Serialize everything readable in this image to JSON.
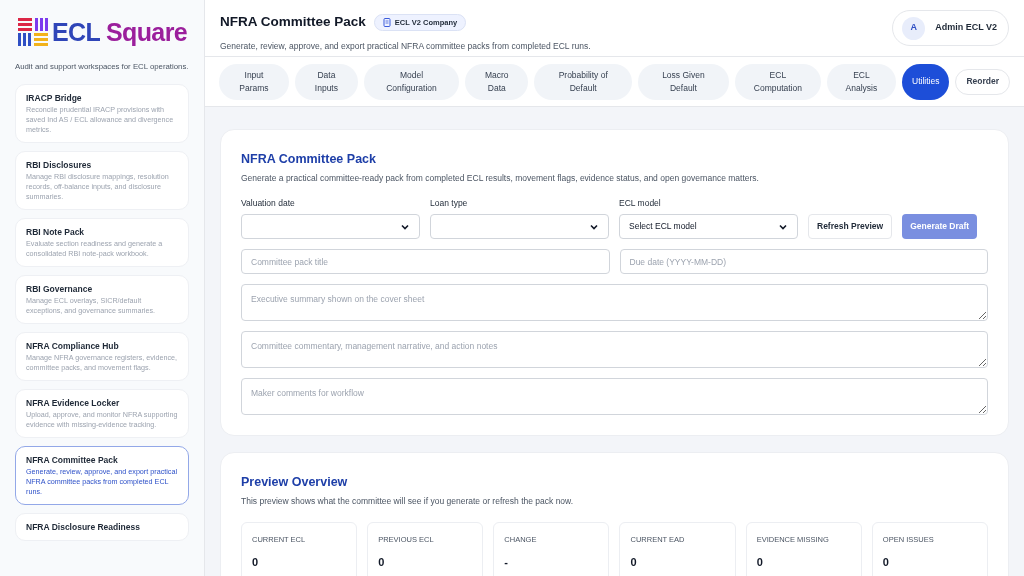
{
  "sidebar": {
    "logo": {
      "word1": "ECL",
      "word2": "Square"
    },
    "tagline": "Audit and support workspaces for ECL operations.",
    "items": [
      {
        "title": "IRACP Bridge",
        "description": "Reconcile prudential IRACP provisions with saved Ind AS / ECL allowance and divergence metrics.",
        "selected": false
      },
      {
        "title": "RBI Disclosures",
        "description": "Manage RBI disclosure mappings, resolution records, off-balance inputs, and disclosure summaries.",
        "selected": false
      },
      {
        "title": "RBI Note Pack",
        "description": "Evaluate section readiness and generate a consolidated RBI note-pack workbook.",
        "selected": false
      },
      {
        "title": "RBI Governance",
        "description": "Manage ECL overlays, SICR/default exceptions, and governance summaries.",
        "selected": false
      },
      {
        "title": "NFRA Compliance Hub",
        "description": "Manage NFRA governance registers, evidence, committee packs, and movement flags.",
        "selected": false
      },
      {
        "title": "NFRA Evidence Locker",
        "description": "Upload, approve, and monitor NFRA supporting evidence with missing-evidence tracking.",
        "selected": false
      },
      {
        "title": "NFRA Committee Pack",
        "description": "Generate, review, approve, and export practical NFRA committee packs from completed ECL runs.",
        "selected": true
      },
      {
        "title": "NFRA Disclosure Readiness",
        "selected": false
      }
    ]
  },
  "header": {
    "title": "NFRA Committee Pack",
    "company": "ECL V2 Company",
    "subtitle": "Generate, review, approve, and export practical NFRA committee packs from completed ECL runs.",
    "user": {
      "initial": "A",
      "name": "Admin ECL V2"
    }
  },
  "tabs": [
    {
      "label": "Input Params",
      "selected": false
    },
    {
      "label": "Data Inputs",
      "selected": false
    },
    {
      "label": "Model Configuration",
      "selected": false
    },
    {
      "label": "Macro Data",
      "selected": false
    },
    {
      "label": "Probability of Default",
      "selected": false
    },
    {
      "label": "Loss Given Default",
      "selected": false
    },
    {
      "label": "ECL Computation",
      "selected": false
    },
    {
      "label": "ECL Analysis",
      "selected": false
    },
    {
      "label": "Utilities",
      "selected": true
    }
  ],
  "reorder_button": "Reorder",
  "pack_form": {
    "title": "NFRA Committee Pack",
    "description": "Generate a practical committee-ready pack from completed ECL results, movement flags, evidence status, and open governance matters.",
    "selects": [
      {
        "label": "Valuation date"
      },
      {
        "label": "Loan type"
      },
      {
        "label": "ECL model",
        "value": "Select ECL model"
      }
    ],
    "refresh_button": "Refresh Preview",
    "generate_button": {
      "label": "Generate Draft",
      "disabled": true
    },
    "title_field": {
      "placeholder": "Committee pack title"
    },
    "due_field": {
      "placeholder": "Due date (YYYY-MM-DD)"
    },
    "textareas": [
      {
        "placeholder": "Executive summary shown on the cover sheet"
      },
      {
        "placeholder": "Committee commentary, management narrative, and action notes"
      },
      {
        "placeholder": "Maker comments for workflow"
      }
    ]
  },
  "preview": {
    "title": "Preview Overview",
    "description": "This preview shows what the committee will see if you generate or refresh the pack now.",
    "metrics": [
      {
        "label": "CURRENT ECL",
        "value": "0"
      },
      {
        "label": "PREVIOUS ECL",
        "value": "0"
      },
      {
        "label": "CHANGE",
        "value": "-"
      },
      {
        "label": "CURRENT EAD",
        "value": "0"
      },
      {
        "label": "EVIDENCE MISSING",
        "value": "0"
      },
      {
        "label": "OPEN ISSUES",
        "value": "0"
      }
    ]
  }
}
